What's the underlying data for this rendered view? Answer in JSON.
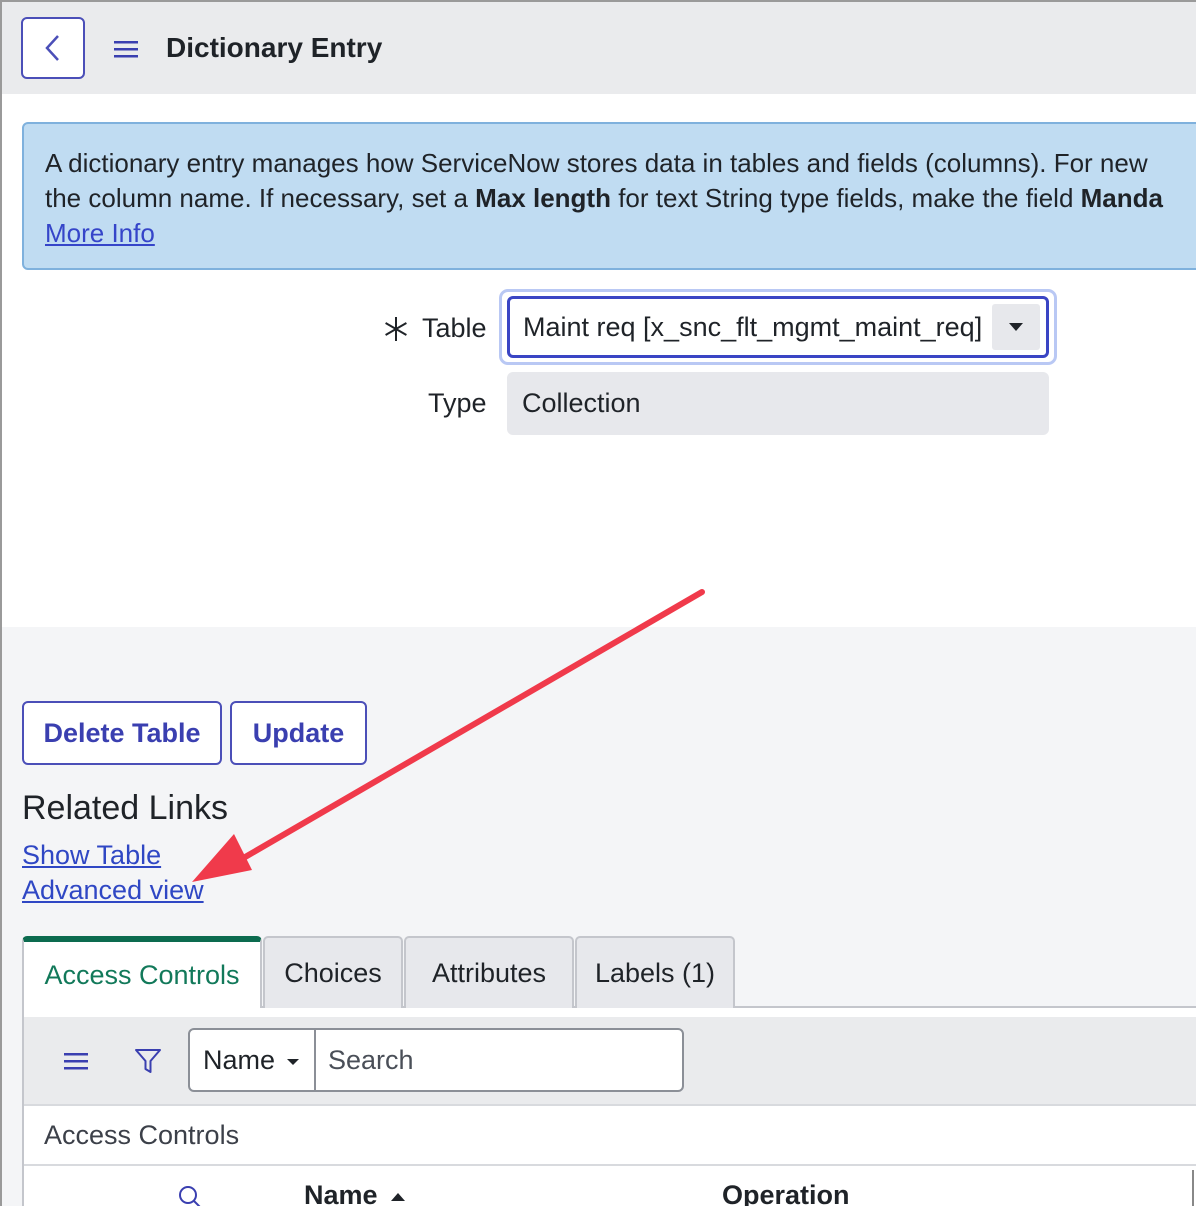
{
  "header": {
    "title": "Dictionary Entry"
  },
  "info_banner": {
    "line1": "A dictionary entry manages how ServiceNow stores data in tables and fields (columns). For new",
    "line2_a": "the column name. If necessary, set a ",
    "line2_b": "Max length",
    "line2_c": " for text String type fields, make the field ",
    "line2_d": "Manda",
    "link": "More Info"
  },
  "form": {
    "table_label": "Table",
    "table_value": "Maint req [x_snc_flt_mgmt_maint_req]",
    "type_label": "Type",
    "type_value": "Collection"
  },
  "actions": {
    "delete_table": "Delete Table",
    "update": "Update"
  },
  "related_links": {
    "title": "Related Links",
    "show_table": "Show Table",
    "advanced_view": "Advanced view"
  },
  "tabs": [
    {
      "label": "Access Controls",
      "active": true
    },
    {
      "label": "Choices",
      "active": false
    },
    {
      "label": "Attributes",
      "active": false
    },
    {
      "label": "Labels (1)",
      "active": false
    }
  ],
  "list": {
    "field_select": "Name",
    "search_placeholder": "Search",
    "caption": "Access Controls",
    "columns": [
      "Name",
      "Operation"
    ]
  },
  "colors": {
    "primary": "#3a45c4",
    "active_tab": "#0c6b4f",
    "banner": "#c0dcf2",
    "annotation_arrow": "#f03a4b"
  },
  "icons": [
    "chevron-left-icon",
    "hamburger-icon",
    "asterisk-icon",
    "caret-down-icon",
    "filter-icon",
    "search-icon",
    "sort-ascending-icon",
    "arrow-annotation"
  ]
}
